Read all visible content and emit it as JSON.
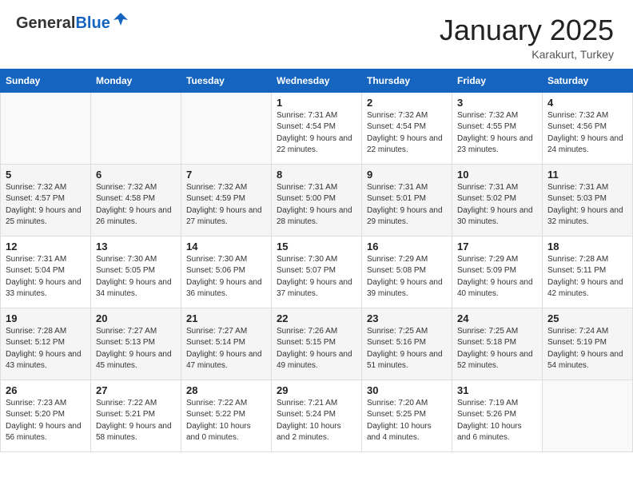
{
  "logo": {
    "general": "General",
    "blue": "Blue"
  },
  "title": "January 2025",
  "location": "Karakurt, Turkey",
  "weekdays": [
    "Sunday",
    "Monday",
    "Tuesday",
    "Wednesday",
    "Thursday",
    "Friday",
    "Saturday"
  ],
  "weeks": [
    [
      {
        "day": "",
        "sunrise": "",
        "sunset": "",
        "daylight": ""
      },
      {
        "day": "",
        "sunrise": "",
        "sunset": "",
        "daylight": ""
      },
      {
        "day": "",
        "sunrise": "",
        "sunset": "",
        "daylight": ""
      },
      {
        "day": "1",
        "sunrise": "Sunrise: 7:31 AM",
        "sunset": "Sunset: 4:54 PM",
        "daylight": "Daylight: 9 hours and 22 minutes."
      },
      {
        "day": "2",
        "sunrise": "Sunrise: 7:32 AM",
        "sunset": "Sunset: 4:54 PM",
        "daylight": "Daylight: 9 hours and 22 minutes."
      },
      {
        "day": "3",
        "sunrise": "Sunrise: 7:32 AM",
        "sunset": "Sunset: 4:55 PM",
        "daylight": "Daylight: 9 hours and 23 minutes."
      },
      {
        "day": "4",
        "sunrise": "Sunrise: 7:32 AM",
        "sunset": "Sunset: 4:56 PM",
        "daylight": "Daylight: 9 hours and 24 minutes."
      }
    ],
    [
      {
        "day": "5",
        "sunrise": "Sunrise: 7:32 AM",
        "sunset": "Sunset: 4:57 PM",
        "daylight": "Daylight: 9 hours and 25 minutes."
      },
      {
        "day": "6",
        "sunrise": "Sunrise: 7:32 AM",
        "sunset": "Sunset: 4:58 PM",
        "daylight": "Daylight: 9 hours and 26 minutes."
      },
      {
        "day": "7",
        "sunrise": "Sunrise: 7:32 AM",
        "sunset": "Sunset: 4:59 PM",
        "daylight": "Daylight: 9 hours and 27 minutes."
      },
      {
        "day": "8",
        "sunrise": "Sunrise: 7:31 AM",
        "sunset": "Sunset: 5:00 PM",
        "daylight": "Daylight: 9 hours and 28 minutes."
      },
      {
        "day": "9",
        "sunrise": "Sunrise: 7:31 AM",
        "sunset": "Sunset: 5:01 PM",
        "daylight": "Daylight: 9 hours and 29 minutes."
      },
      {
        "day": "10",
        "sunrise": "Sunrise: 7:31 AM",
        "sunset": "Sunset: 5:02 PM",
        "daylight": "Daylight: 9 hours and 30 minutes."
      },
      {
        "day": "11",
        "sunrise": "Sunrise: 7:31 AM",
        "sunset": "Sunset: 5:03 PM",
        "daylight": "Daylight: 9 hours and 32 minutes."
      }
    ],
    [
      {
        "day": "12",
        "sunrise": "Sunrise: 7:31 AM",
        "sunset": "Sunset: 5:04 PM",
        "daylight": "Daylight: 9 hours and 33 minutes."
      },
      {
        "day": "13",
        "sunrise": "Sunrise: 7:30 AM",
        "sunset": "Sunset: 5:05 PM",
        "daylight": "Daylight: 9 hours and 34 minutes."
      },
      {
        "day": "14",
        "sunrise": "Sunrise: 7:30 AM",
        "sunset": "Sunset: 5:06 PM",
        "daylight": "Daylight: 9 hours and 36 minutes."
      },
      {
        "day": "15",
        "sunrise": "Sunrise: 7:30 AM",
        "sunset": "Sunset: 5:07 PM",
        "daylight": "Daylight: 9 hours and 37 minutes."
      },
      {
        "day": "16",
        "sunrise": "Sunrise: 7:29 AM",
        "sunset": "Sunset: 5:08 PM",
        "daylight": "Daylight: 9 hours and 39 minutes."
      },
      {
        "day": "17",
        "sunrise": "Sunrise: 7:29 AM",
        "sunset": "Sunset: 5:09 PM",
        "daylight": "Daylight: 9 hours and 40 minutes."
      },
      {
        "day": "18",
        "sunrise": "Sunrise: 7:28 AM",
        "sunset": "Sunset: 5:11 PM",
        "daylight": "Daylight: 9 hours and 42 minutes."
      }
    ],
    [
      {
        "day": "19",
        "sunrise": "Sunrise: 7:28 AM",
        "sunset": "Sunset: 5:12 PM",
        "daylight": "Daylight: 9 hours and 43 minutes."
      },
      {
        "day": "20",
        "sunrise": "Sunrise: 7:27 AM",
        "sunset": "Sunset: 5:13 PM",
        "daylight": "Daylight: 9 hours and 45 minutes."
      },
      {
        "day": "21",
        "sunrise": "Sunrise: 7:27 AM",
        "sunset": "Sunset: 5:14 PM",
        "daylight": "Daylight: 9 hours and 47 minutes."
      },
      {
        "day": "22",
        "sunrise": "Sunrise: 7:26 AM",
        "sunset": "Sunset: 5:15 PM",
        "daylight": "Daylight: 9 hours and 49 minutes."
      },
      {
        "day": "23",
        "sunrise": "Sunrise: 7:25 AM",
        "sunset": "Sunset: 5:16 PM",
        "daylight": "Daylight: 9 hours and 51 minutes."
      },
      {
        "day": "24",
        "sunrise": "Sunrise: 7:25 AM",
        "sunset": "Sunset: 5:18 PM",
        "daylight": "Daylight: 9 hours and 52 minutes."
      },
      {
        "day": "25",
        "sunrise": "Sunrise: 7:24 AM",
        "sunset": "Sunset: 5:19 PM",
        "daylight": "Daylight: 9 hours and 54 minutes."
      }
    ],
    [
      {
        "day": "26",
        "sunrise": "Sunrise: 7:23 AM",
        "sunset": "Sunset: 5:20 PM",
        "daylight": "Daylight: 9 hours and 56 minutes."
      },
      {
        "day": "27",
        "sunrise": "Sunrise: 7:22 AM",
        "sunset": "Sunset: 5:21 PM",
        "daylight": "Daylight: 9 hours and 58 minutes."
      },
      {
        "day": "28",
        "sunrise": "Sunrise: 7:22 AM",
        "sunset": "Sunset: 5:22 PM",
        "daylight": "Daylight: 10 hours and 0 minutes."
      },
      {
        "day": "29",
        "sunrise": "Sunrise: 7:21 AM",
        "sunset": "Sunset: 5:24 PM",
        "daylight": "Daylight: 10 hours and 2 minutes."
      },
      {
        "day": "30",
        "sunrise": "Sunrise: 7:20 AM",
        "sunset": "Sunset: 5:25 PM",
        "daylight": "Daylight: 10 hours and 4 minutes."
      },
      {
        "day": "31",
        "sunrise": "Sunrise: 7:19 AM",
        "sunset": "Sunset: 5:26 PM",
        "daylight": "Daylight: 10 hours and 6 minutes."
      },
      {
        "day": "",
        "sunrise": "",
        "sunset": "",
        "daylight": ""
      }
    ]
  ]
}
